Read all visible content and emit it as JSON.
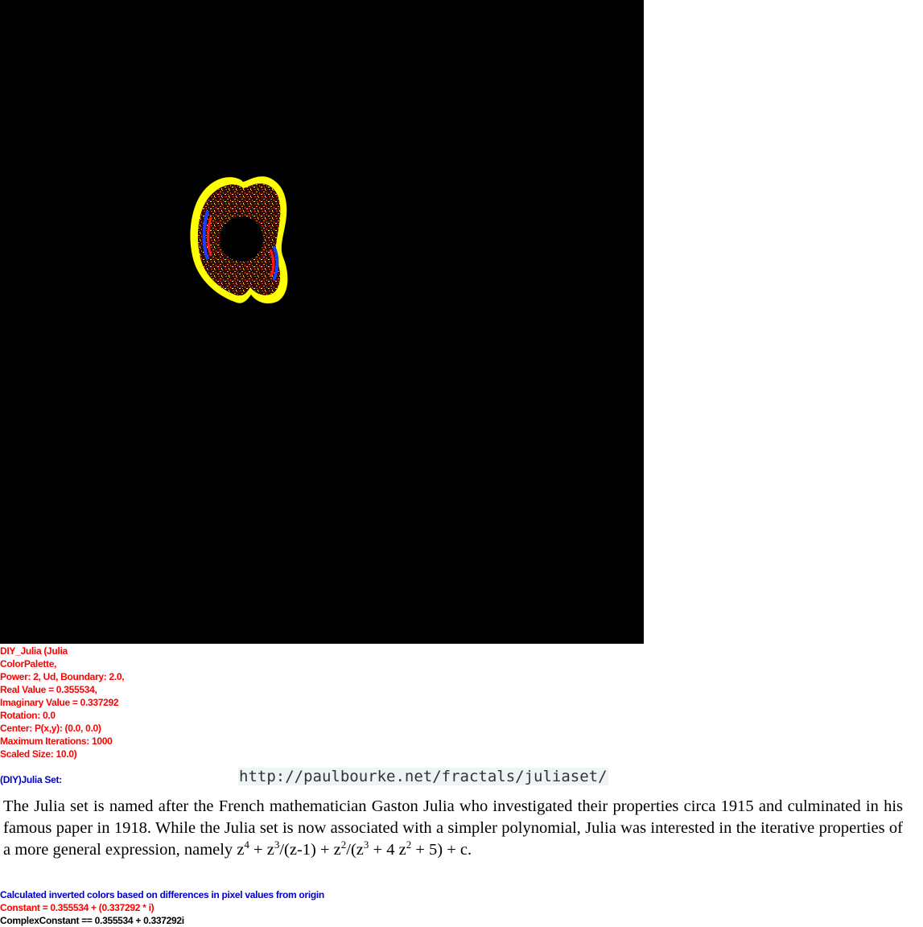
{
  "colors": {
    "canvas_bg": "#000000",
    "outer_ring": "#ffff00",
    "param_text": "#ff0000",
    "label_text": "#0000cc",
    "url_bg": "#eef3f6"
  },
  "params": {
    "lines": [
      "DIY_Julia (Julia",
      "ColorPalette,",
      "Power: 2, Ud, Boundary: 2.0,",
      "Real Value = 0.355534,",
      "Imaginary Value = 0.337292",
      "Rotation: 0.0",
      "Center: P(x,y): (0.0, 0.0)",
      "Maximum Iterations: 1000",
      "Scaled Size: 10.0)"
    ]
  },
  "set_label": "(DIY)Julia Set:",
  "url": "http://paulbourke.net/fractals/juliaset/",
  "description": {
    "text": "The Julia set is named after the French mathematician Gaston Julia who investigated their properties circa 1915 and culminated in his famous paper in 1918. While the Julia set is now associated with a simpler polynomial, Julia was interested in the iterative properties of a more general expression, namely ",
    "formula": {
      "t1": "z",
      "e1": "4",
      "t2": " + z",
      "e2": "3",
      "t3": "/(z-1) + z",
      "e3": "2",
      "t4": "/(z",
      "e4": "3",
      "t5": " + 4 z",
      "e5": "2",
      "t6": " + 5) + c."
    }
  },
  "footer": {
    "line1": "Calculated inverted colors based on differences in pixel values from origin",
    "line2": "Constant = 0.355534 + (0.337292 * i)",
    "line3": "ComplexConstant == 0.355534 + 0.337292i"
  }
}
